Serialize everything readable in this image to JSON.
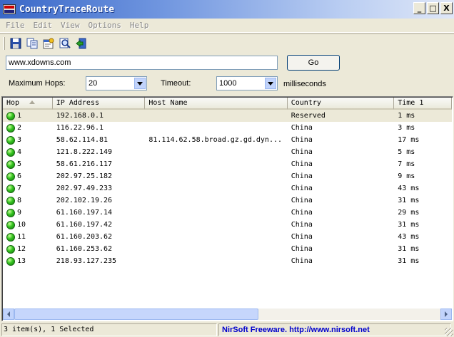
{
  "window": {
    "title": "CountryTraceRoute"
  },
  "window_buttons": {
    "minimize": "_",
    "maximize": "□",
    "close": "X"
  },
  "menu": [
    "File",
    "Edit",
    "View",
    "Options",
    "Help"
  ],
  "toolbar": [
    "save-icon",
    "copy-icon",
    "properties-icon",
    "find-icon",
    "exit-icon"
  ],
  "host": {
    "value": "www.xdowns.com"
  },
  "go_label": "Go",
  "max_hops": {
    "label": "Maximum Hops:",
    "value": "20"
  },
  "timeout": {
    "label": "Timeout:",
    "value": "1000",
    "unit": "milliseconds"
  },
  "columns": [
    "Hop",
    "IP Address",
    "Host Name",
    "Country",
    "Time 1"
  ],
  "rows": [
    {
      "hop": "1",
      "ip": "192.168.0.1",
      "host": "",
      "country": "Reserved",
      "time": "1 ms"
    },
    {
      "hop": "2",
      "ip": "116.22.96.1",
      "host": "",
      "country": "China",
      "time": "3 ms"
    },
    {
      "hop": "3",
      "ip": "58.62.114.81",
      "host": "81.114.62.58.broad.gz.gd.dyn...",
      "country": "China",
      "time": "17 ms"
    },
    {
      "hop": "4",
      "ip": "121.8.222.149",
      "host": "",
      "country": "China",
      "time": "5 ms"
    },
    {
      "hop": "5",
      "ip": "58.61.216.117",
      "host": "",
      "country": "China",
      "time": "7 ms"
    },
    {
      "hop": "6",
      "ip": "202.97.25.182",
      "host": "",
      "country": "China",
      "time": "9 ms"
    },
    {
      "hop": "7",
      "ip": "202.97.49.233",
      "host": "",
      "country": "China",
      "time": "43 ms"
    },
    {
      "hop": "8",
      "ip": "202.102.19.26",
      "host": "",
      "country": "China",
      "time": "31 ms"
    },
    {
      "hop": "9",
      "ip": "61.160.197.14",
      "host": "",
      "country": "China",
      "time": "29 ms"
    },
    {
      "hop": "10",
      "ip": "61.160.197.42",
      "host": "",
      "country": "China",
      "time": "31 ms"
    },
    {
      "hop": "11",
      "ip": "61.160.203.62",
      "host": "",
      "country": "China",
      "time": "43 ms"
    },
    {
      "hop": "12",
      "ip": "61.160.253.62",
      "host": "",
      "country": "China",
      "time": "31 ms"
    },
    {
      "hop": "13",
      "ip": "218.93.127.235",
      "host": "",
      "country": "China",
      "time": "31 ms"
    }
  ],
  "status": {
    "left": "3 item(s), 1 Selected",
    "right": "NirSoft Freeware.  http://www.nirsoft.net"
  },
  "colors": {
    "title_gradient_start": "#3a68c8",
    "status_link": "#0000cc",
    "hop_ok": "#35c31f"
  }
}
